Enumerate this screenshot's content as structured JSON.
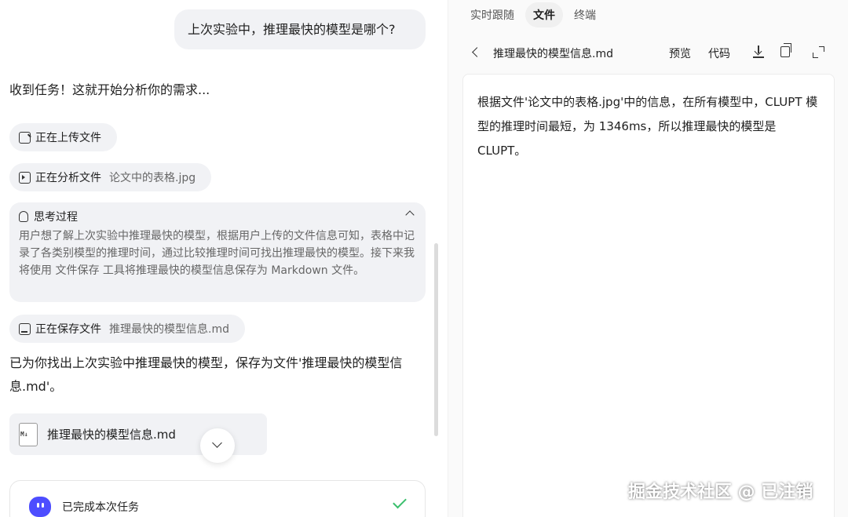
{
  "chat": {
    "user_message": "上次实验中，推理最快的模型是哪个?",
    "ai_intro": "收到任务！这就开始分析你的需求...",
    "steps": [
      {
        "label": "正在上传文件",
        "detail": ""
      },
      {
        "label": "正在分析文件",
        "detail": "论文中的表格.jpg"
      },
      {
        "label": "正在保存文件",
        "detail": "推理最快的模型信息.md"
      }
    ],
    "thinking": {
      "title": "思考过程",
      "body": "用户想了解上次实验中推理最快的模型，根据用户上传的文件信息可知，表格中记录了各类别模型的推理时间，通过比较推理时间可找出推理最快的模型。接下来我将使用 文件保存 工具将推理最快的模型信息保存为 Markdown 文件。"
    },
    "result_text_line1": "已为你找出上次实验中推理最快的模型，保存为文件'推理最快的模型信",
    "result_text_line2": "息.md'。",
    "file_card": {
      "name": "推理最快的模型信息.md",
      "icon_label": "M↓"
    },
    "done": {
      "label": "已完成本次任务"
    }
  },
  "panel": {
    "tabs": [
      "实时跟随",
      "文件",
      "终端"
    ],
    "active_tab": "文件",
    "file_title": "推理最快的模型信息.md",
    "view_modes": [
      "预览",
      "代码"
    ],
    "content": "根据文件'论文中的表格.jpg'中的信息，在所有模型中，CLUPT 模型的推理时间最短，为 1346ms，所以推理最快的模型是 CLUPT。"
  },
  "watermark": "掘金技术社区 @ 已注销",
  "colors": {
    "accent": "#4d4dff",
    "success": "#3cbf6e",
    "chip_bg": "#f1f2f5"
  }
}
